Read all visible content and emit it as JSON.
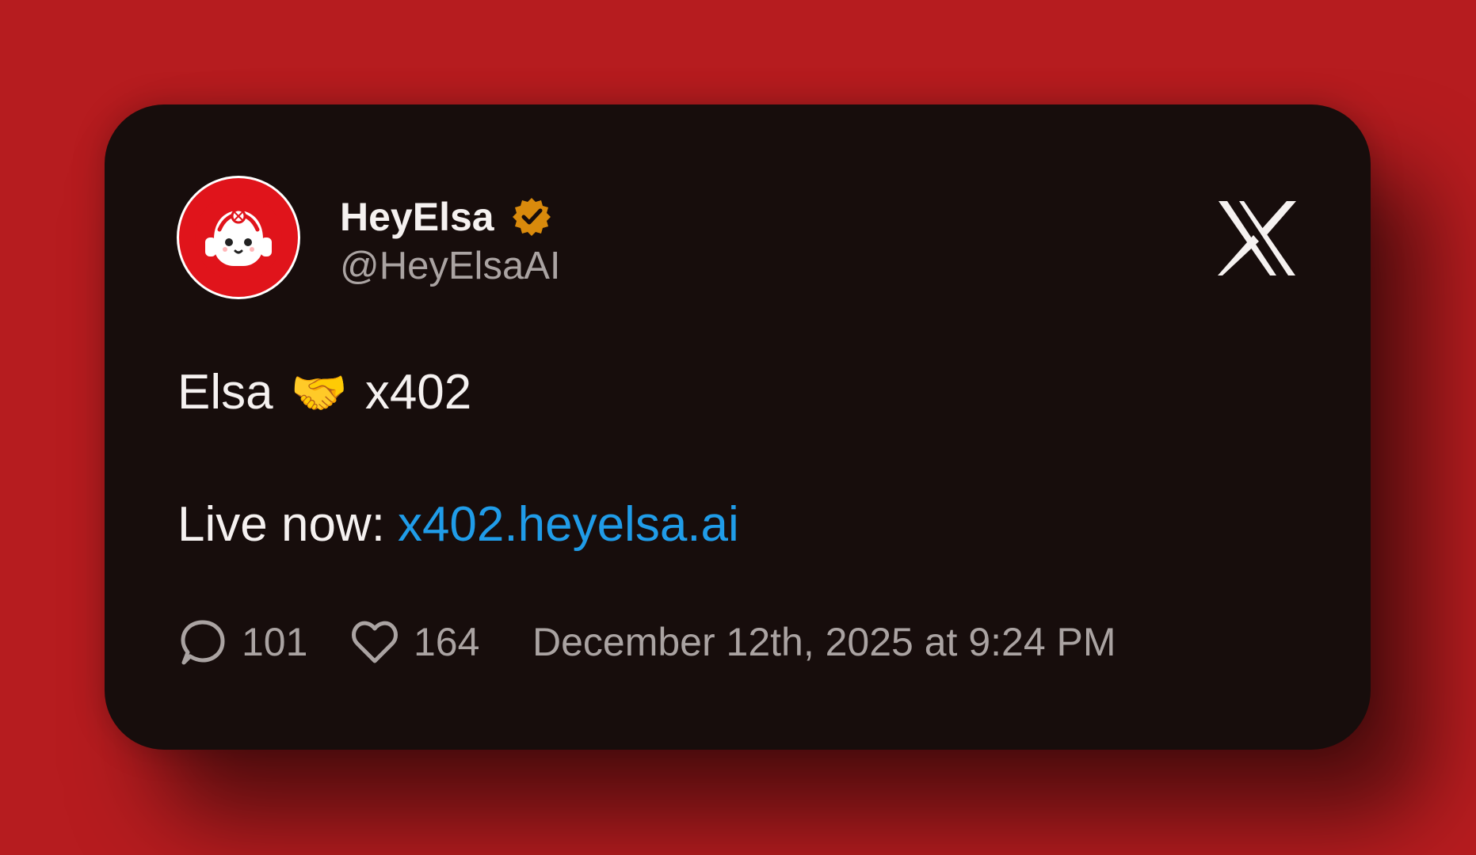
{
  "post": {
    "author": {
      "display_name": "HeyElsa",
      "handle": "@HeyElsaAI",
      "verified_badge": "gold-verified-badge-icon",
      "avatar": "robot-avatar-icon"
    },
    "platform_logo": "x-logo-icon",
    "content": {
      "line1_text": "Elsa",
      "emoji": "🤝",
      "line1_suffix": "x402",
      "line2_prefix": "Live now:",
      "link_text": "x402.heyelsa.ai"
    },
    "stats": {
      "reply_count": "101",
      "like_count": "164",
      "timestamp": "December 12th, 2025 at 9:24 PM",
      "reply_icon": "comment-icon",
      "like_icon": "heart-icon"
    }
  },
  "colors": {
    "background": "#b61c1f",
    "card": "#170d0c",
    "primary_text": "#f5f1f0",
    "secondary_text": "#aaa3a2",
    "link": "#209ce8",
    "badge": "#d98a0c",
    "avatar": "#e0141b"
  }
}
